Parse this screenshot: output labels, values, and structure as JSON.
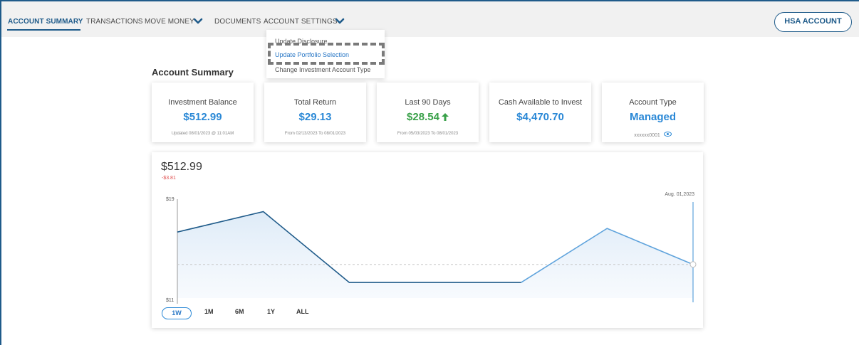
{
  "nav": {
    "items": [
      {
        "label": "ACCOUNT SUMMARY"
      },
      {
        "label": "TRANSACTIONS"
      },
      {
        "label": "MOVE MONEY"
      },
      {
        "label": "DOCUMENTS"
      },
      {
        "label": "ACCOUNT SETTINGS"
      }
    ],
    "hsa_button": "HSA ACCOUNT"
  },
  "dropdown": {
    "items": [
      {
        "label": "Update Disclosure"
      },
      {
        "label": "Update Portfolio Selection"
      },
      {
        "label": "Change Investment Account Type"
      }
    ]
  },
  "page_title": "Account Summary",
  "cards": [
    {
      "label": "Investment Balance",
      "value": "$512.99",
      "sub": "Updated 08/01/2023 @ 11:01AM"
    },
    {
      "label": "Total Return",
      "value": "$29.13",
      "sub": "From 02/13/2023 To 08/01/2023"
    },
    {
      "label": "Last 90 Days",
      "value": "$28.54",
      "sub": "From 05/03/2023 To 08/01/2023"
    },
    {
      "label": "Cash Available to Invest",
      "value": "$4,470.70",
      "sub": ""
    },
    {
      "label": "Account Type",
      "value": "Managed",
      "sub": "xxxxxx0001"
    }
  ],
  "chart": {
    "balance": "$512.99",
    "change": "-$3.81",
    "hover_date": "Aug. 01,2023",
    "ranges": [
      "1W",
      "1M",
      "6M",
      "1Y",
      "ALL"
    ],
    "selected_range": "1W"
  },
  "chart_data": {
    "type": "area",
    "yticks": [
      "$19",
      "$11"
    ],
    "ylim": [
      11,
      19
    ],
    "x": [
      0,
      1,
      2,
      3,
      4,
      5,
      6
    ],
    "values": [
      16.5,
      18.2,
      12.3,
      12.3,
      12.3,
      16.8,
      13.8
    ],
    "reference_value": 13.8,
    "colors": {
      "left_line": "#1f5b8a",
      "right_line": "#5fa3dc",
      "fill": "#dceaf7"
    }
  },
  "colors": {
    "brand": "#1f5b8a",
    "accent": "#2a88d6",
    "positive": "#3aa14a",
    "negative": "#e05050"
  }
}
